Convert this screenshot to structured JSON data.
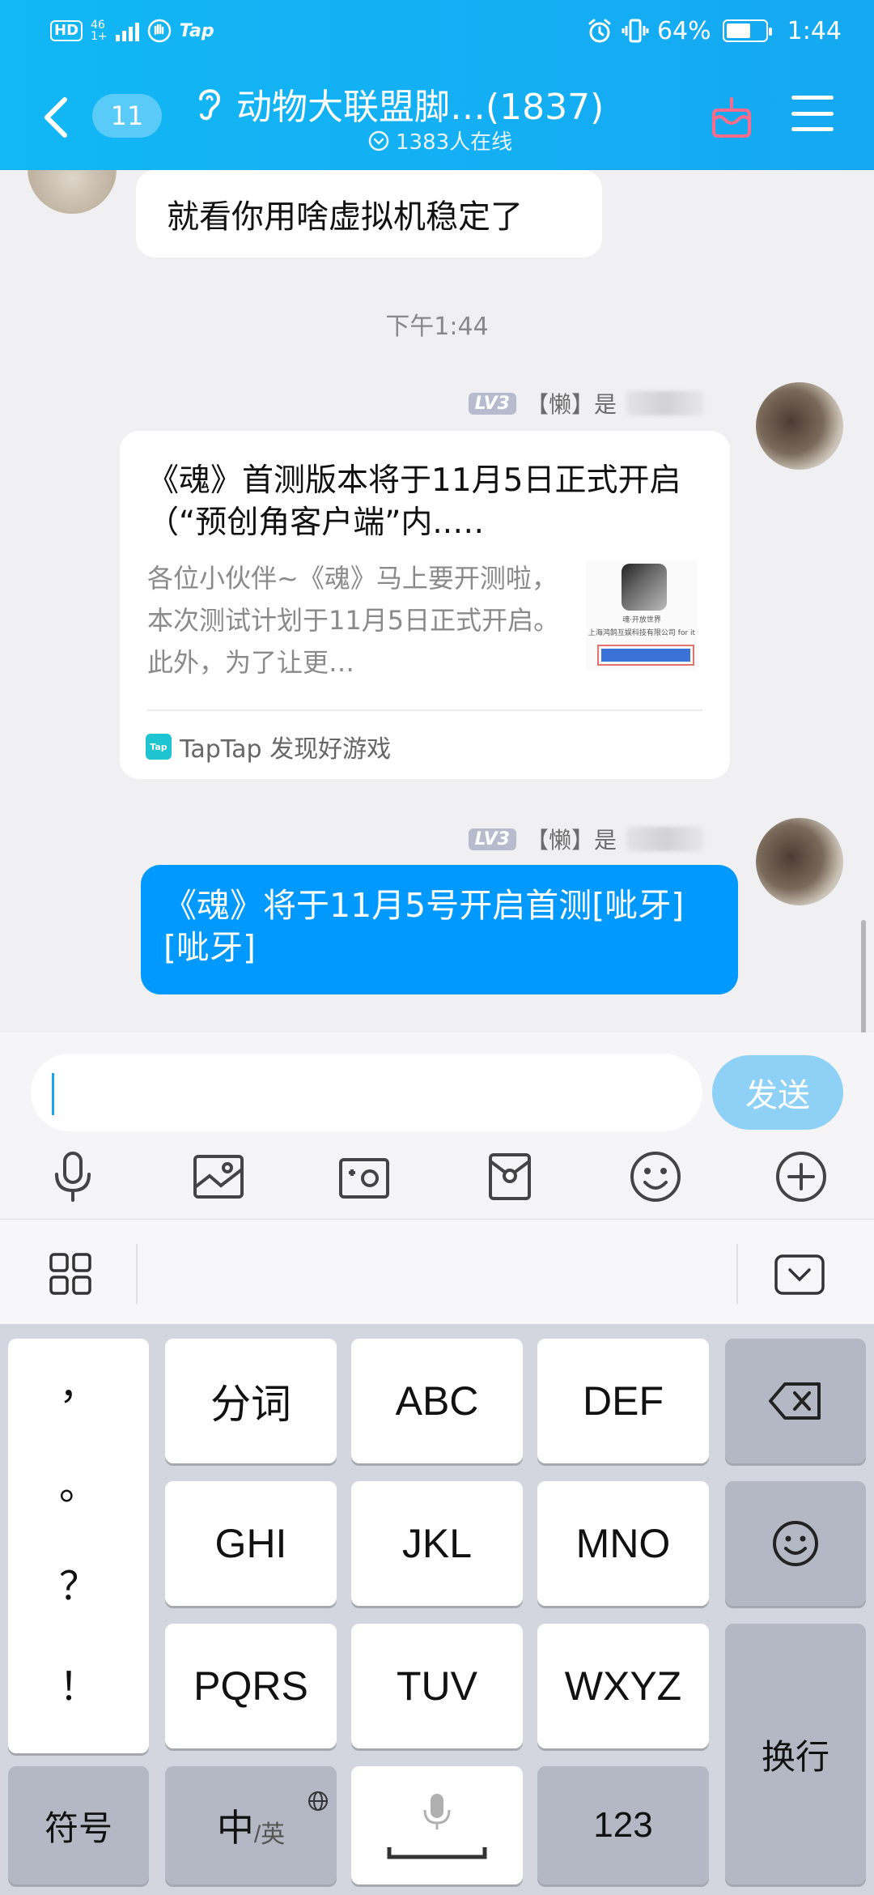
{
  "status_bar": {
    "left": {
      "hd": "HD",
      "net": "46",
      "net_sub": "1+",
      "app_label": "Tap"
    },
    "right": {
      "battery": "64%",
      "time": "1:44"
    },
    "battery_level": 0.64
  },
  "header": {
    "unread_count": "11",
    "title": "动物大联盟脚…",
    "member_count": "(1837)",
    "online": "1383人在线"
  },
  "chat": {
    "previous_message": "就看你用啥虚拟机稳定了",
    "timestamp": "下午1:44",
    "messages": [
      {
        "level": "LV3",
        "sender": "【懒】是",
        "card": {
          "title": "《魂》首测版本将于11月5日正式开启（“预创角客户端”内..…",
          "description": "各位小伙伴~《魂》马上要开测啦，本次测试计划于11月5日正式开启。此外，为了让更…",
          "thumb_text": "魂·开放世界",
          "thumb_sub": "上海鸿鹄互娱科技有限公司 for it",
          "source_logo": "Tap",
          "source": "TapTap 发现好游戏"
        }
      },
      {
        "level": "LV3",
        "sender": "【懒】是",
        "text": "《魂》将于11月5号开启首测[呲牙][呲牙]"
      }
    ]
  },
  "input": {
    "value": "",
    "send_label": "发送"
  },
  "keyboard": {
    "punctuation": [
      "，",
      "。",
      "？",
      "！"
    ],
    "row1": [
      "分词",
      "ABC",
      "DEF"
    ],
    "row2": [
      "GHI",
      "JKL",
      "MNO"
    ],
    "row3": [
      "PQRS",
      "TUV",
      "WXYZ"
    ],
    "symbol_label": "符号",
    "lang_main": "中",
    "lang_sub": "/英",
    "num_label": "123",
    "enter_label": "换行"
  },
  "colors": {
    "header": "#12b7f5",
    "accent": "#0099ff",
    "send_disabled": "#8fd0f6"
  }
}
